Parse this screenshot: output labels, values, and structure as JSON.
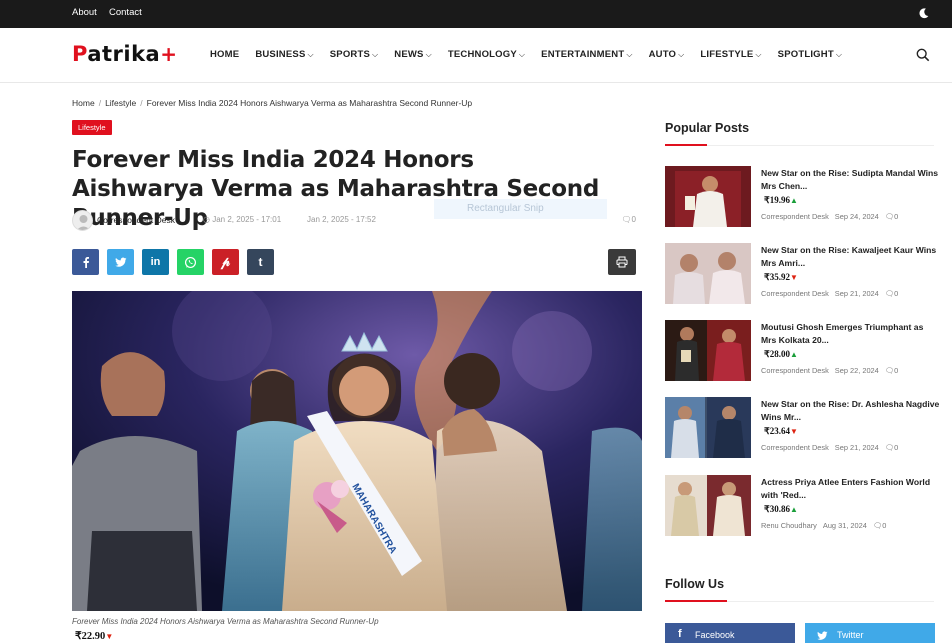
{
  "topbar": {
    "about": "About",
    "contact": "Contact"
  },
  "header": {
    "logo": "Patrika+",
    "nav": [
      "HOME",
      "BUSINESS",
      "SPORTS",
      "NEWS",
      "TECHNOLOGY",
      "ENTERTAINMENT",
      "AUTO",
      "LIFESTYLE",
      "SPOTLIGHT"
    ]
  },
  "breadcrumb": {
    "home": "Home",
    "section": "Lifestyle",
    "current": "Forever Miss India 2024 Honors Aishwarya Verma as Maharashtra Second Runner-Up"
  },
  "article": {
    "category": "Lifestyle",
    "title": "Forever Miss India 2024 Honors Aishwarya Verma as Maharashtra Second Runner-Up",
    "author": "Correspondent Desk",
    "published": "Jan 2, 2025 - 17:01",
    "updated": "Jan 2, 2025 - 17:52",
    "comments": "0",
    "caption": "Forever Miss India 2024 Honors Aishwarya Verma as Maharashtra Second Runner-Up",
    "sash_text": "MAHARASHTRA",
    "price": "₹22.90",
    "snip_tooltip": "Rectangular Snip"
  },
  "sidebar": {
    "popular_title": "Popular Posts",
    "posts": [
      {
        "title": "New Star on the Rise: Sudipta Mandal Wins Mrs Chen...",
        "price": "₹19.96",
        "trend": "up",
        "author": "Correspondent Desk",
        "date": "Sep 24, 2024",
        "comments": "0"
      },
      {
        "title": "New Star on the Rise: Kawaljeet Kaur Wins Mrs Amri...",
        "price": "₹35.92",
        "trend": "down",
        "author": "Correspondent Desk",
        "date": "Sep 21, 2024",
        "comments": "0"
      },
      {
        "title": "Moutusi Ghosh Emerges Triumphant as Mrs Kolkata 20...",
        "price": "₹28.00",
        "trend": "up",
        "author": "Correspondent Desk",
        "date": "Sep 22, 2024",
        "comments": "0"
      },
      {
        "title": "New Star on the Rise: Dr. Ashlesha Nagdive Wins Mr...",
        "price": "₹23.64",
        "trend": "down",
        "author": "Correspondent Desk",
        "date": "Sep 21, 2024",
        "comments": "0"
      },
      {
        "title": "Actress Priya Atlee Enters Fashion World with 'Red...",
        "price": "₹30.86",
        "trend": "up",
        "author": "Renu Choudhary",
        "date": "Aug 31, 2024",
        "comments": "0"
      }
    ],
    "follow_title": "Follow Us",
    "facebook": "Facebook",
    "twitter": "Twitter"
  },
  "colors": {
    "accent": "#e0101e",
    "facebook": "#3b5998",
    "twitter": "#40a9e8",
    "whatsapp": "#25d366",
    "pinterest": "#cb2027",
    "linkedin": "#0e76a8",
    "tumblr": "#35465c"
  }
}
